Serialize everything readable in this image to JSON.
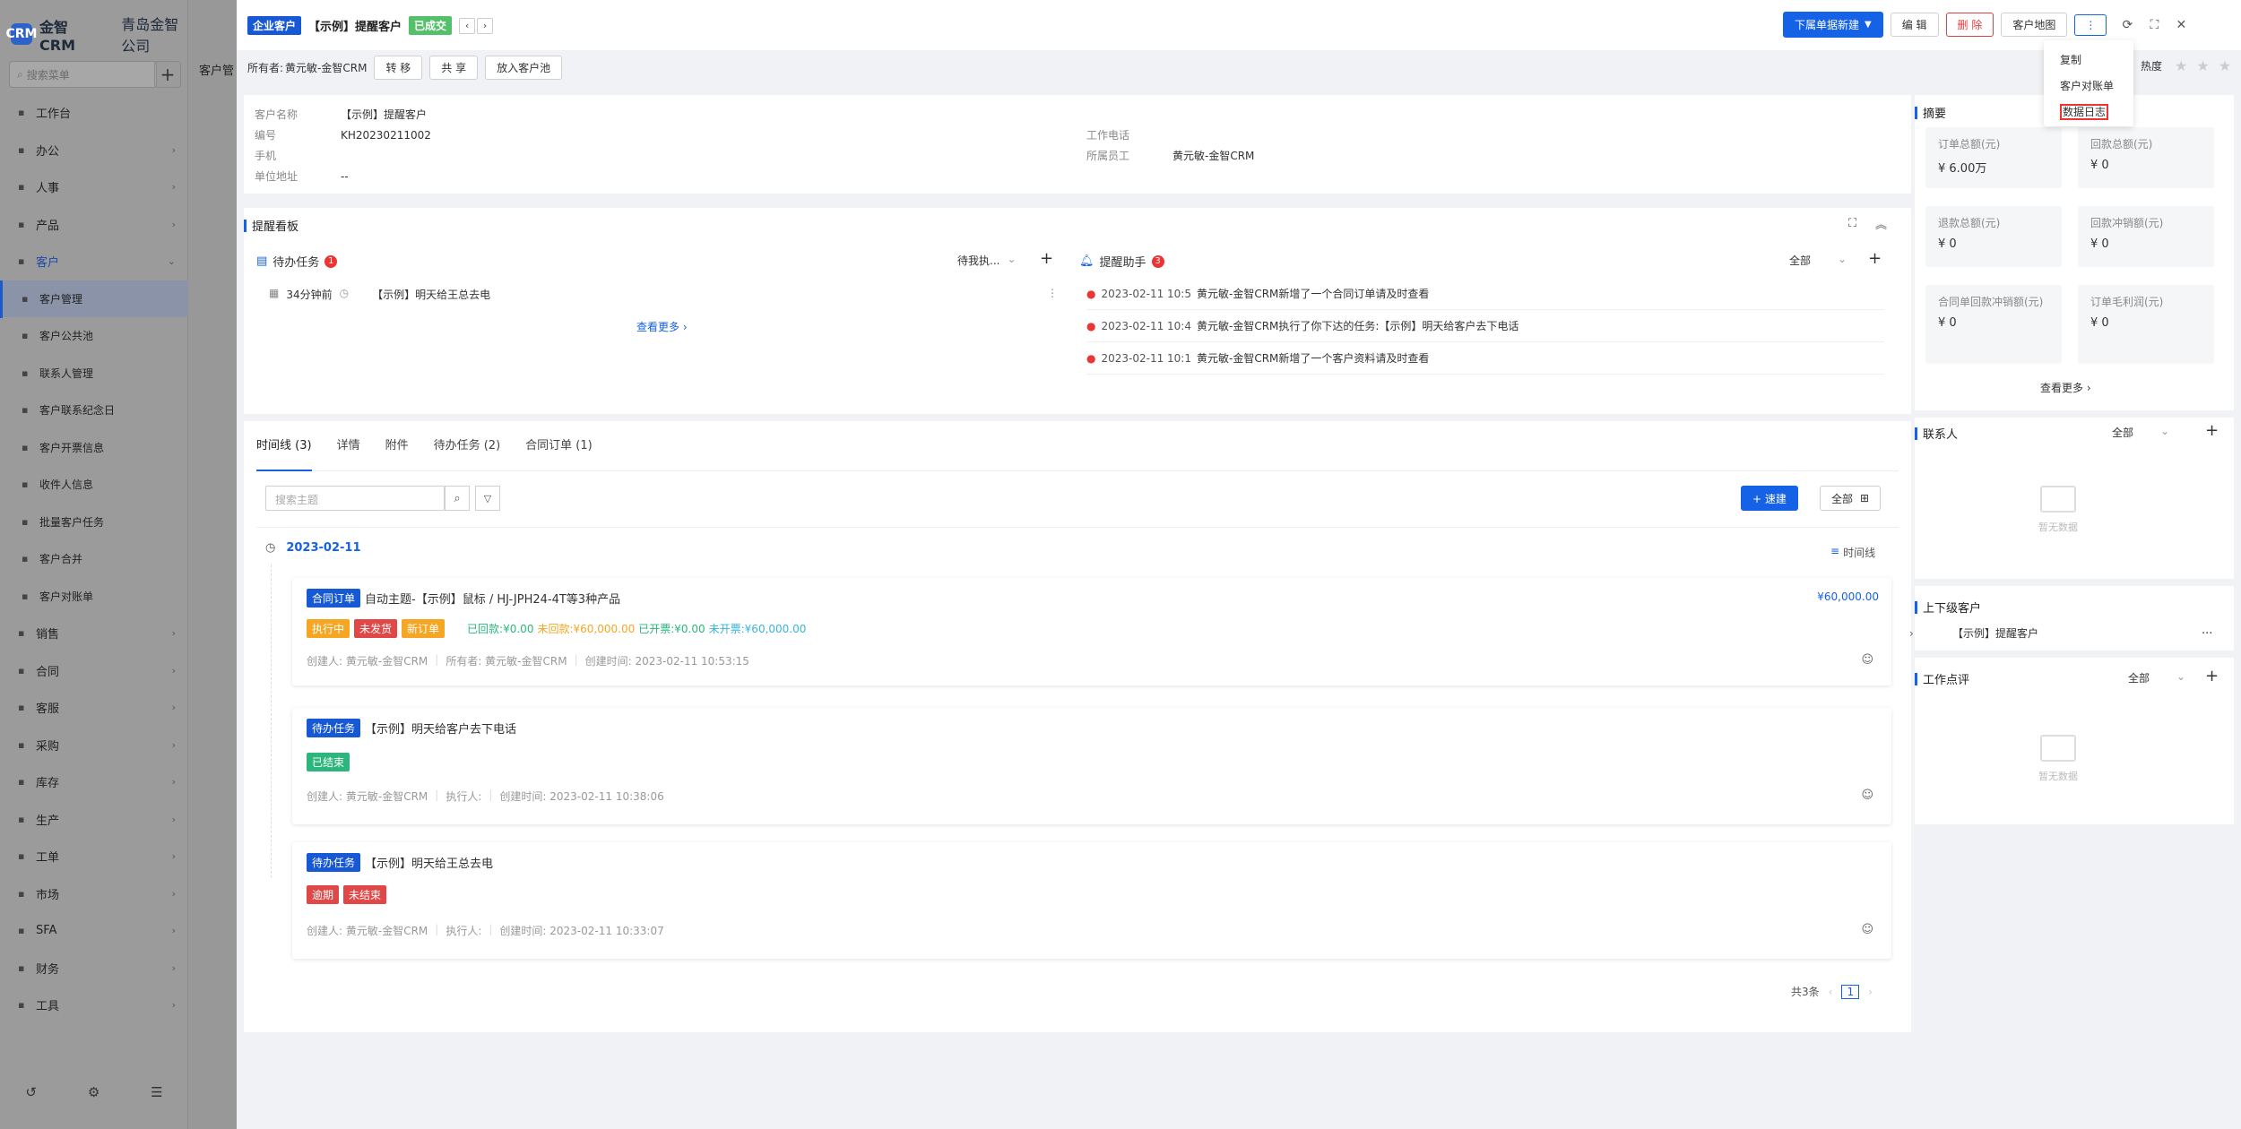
{
  "app": {
    "logo_text": "CRM",
    "name": "金智CRM",
    "company": "青岛金智公司",
    "search_placeholder": "搜索菜单"
  },
  "sidebar": {
    "items": [
      {
        "label": "工作台",
        "icon": "dashboard-icon",
        "arrow": ""
      },
      {
        "label": "办公",
        "icon": "office-icon",
        "arrow": "›"
      },
      {
        "label": "人事",
        "icon": "people-icon",
        "arrow": "›"
      },
      {
        "label": "产品",
        "icon": "product-icon",
        "arrow": "›"
      },
      {
        "label": "客户",
        "icon": "customer-icon",
        "arrow": "⌄"
      },
      {
        "label": "客户管理",
        "sub": true,
        "active": true
      },
      {
        "label": "客户公共池",
        "sub": true
      },
      {
        "label": "联系人管理",
        "sub": true
      },
      {
        "label": "客户联系纪念日",
        "sub": true
      },
      {
        "label": "客户开票信息",
        "sub": true
      },
      {
        "label": "收件人信息",
        "sub": true
      },
      {
        "label": "批量客户任务",
        "sub": true
      },
      {
        "label": "客户合并",
        "sub": true
      },
      {
        "label": "客户对账单",
        "sub": true
      },
      {
        "label": "销售",
        "icon": "sales-icon",
        "arrow": "›"
      },
      {
        "label": "合同",
        "icon": "contract-icon",
        "arrow": "›"
      },
      {
        "label": "客服",
        "icon": "service-icon",
        "arrow": "›"
      },
      {
        "label": "采购",
        "icon": "purchase-icon",
        "arrow": "›"
      },
      {
        "label": "库存",
        "icon": "stock-icon",
        "arrow": "›"
      },
      {
        "label": "生产",
        "icon": "production-icon",
        "arrow": "›"
      },
      {
        "label": "工单",
        "icon": "workorder-icon",
        "arrow": "›"
      },
      {
        "label": "市场",
        "icon": "market-icon",
        "arrow": "›"
      },
      {
        "label": "SFA",
        "icon": "sfa-icon",
        "arrow": "›"
      },
      {
        "label": "财务",
        "icon": "finance-icon",
        "arrow": "›"
      },
      {
        "label": "工具",
        "icon": "tools-icon",
        "arrow": "›"
      }
    ]
  },
  "midtab": "客户管",
  "header": {
    "type_tag": "企业客户",
    "title": "【示例】提醒客户",
    "status_tag": "已成交",
    "owner_label": "所有者:",
    "owner": "黄元敏-金智CRM",
    "transfer": "转 移",
    "share": "共 享",
    "to_pool": "放入客户池",
    "sub_new": "下属单据新建",
    "edit": "编 辑",
    "delete": "删 除",
    "map": "客户地图",
    "more": "⋮",
    "heat_label": "热度"
  },
  "dropdown": {
    "items": [
      "复制",
      "客户对账单",
      "数据日志"
    ]
  },
  "info": {
    "fields": [
      {
        "label": "客户名称",
        "value": "【示例】提醒客户"
      },
      {
        "label": "编号",
        "value": "KH20230211002"
      },
      {
        "label": "手机",
        "value": ""
      },
      {
        "label": "单位地址",
        "value": "--"
      }
    ],
    "right_fields": [
      {
        "label": "工作电话",
        "value": ""
      },
      {
        "label": "所属员工",
        "value": "黄元敏-金智CRM"
      }
    ]
  },
  "reminder": {
    "title": "提醒看板",
    "todo_title": "待办任务",
    "todo_count": "1",
    "todo_filter": "待我执...",
    "todo_item": {
      "time": "34分钟前",
      "text": "【示例】明天给王总去电"
    },
    "view_more": "查看更多 ›",
    "assist_title": "提醒助手",
    "assist_count": "3",
    "assist_filter": "全部",
    "assist_items": [
      {
        "time": "2023-02-11 10:5",
        "text": "黄元敏-金智CRM新增了一个合同订单请及时查看"
      },
      {
        "time": "2023-02-11 10:4",
        "text": "黄元敏-金智CRM执行了你下达的任务:【示例】明天给客户去下电话"
      },
      {
        "time": "2023-02-11 10:1",
        "text": "黄元敏-金智CRM新增了一个客户资料请及时查看"
      }
    ]
  },
  "tabs": [
    {
      "label": "时间线 (3)",
      "active": true
    },
    {
      "label": "详情"
    },
    {
      "label": "附件"
    },
    {
      "label": "待办任务 (2)"
    },
    {
      "label": "合同订单 (1)"
    }
  ],
  "timeline": {
    "search_placeholder": "搜索主题",
    "new_btn": "+ 速建",
    "all_btn": "全部",
    "date": "2023-02-11",
    "view_label": "时间线",
    "card1": {
      "type": "合同订单",
      "title": "自动主题-【示例】鼠标 / HJ-JPH24-4T等3种产品",
      "amount": "¥60,000.00",
      "tags": [
        "执行中",
        "未发货",
        "新订单"
      ],
      "s1l": "已回款:",
      "s1v": "¥0.00",
      "s2l": "未回款:",
      "s2v": "¥60,000.00",
      "s3l": "已开票:",
      "s3v": "¥0.00",
      "s4l": "未开票:",
      "s4v": "¥60,000.00",
      "meta": [
        "创建人: 黄元敏-金智CRM",
        "所有者: 黄元敏-金智CRM",
        "创建时间: 2023-02-11 10:53:15"
      ]
    },
    "card2": {
      "type": "待办任务",
      "title": "【示例】明天给客户去下电话",
      "tag": "已结束",
      "meta": [
        "创建人: 黄元敏-金智CRM",
        "执行人:",
        "创建时间: 2023-02-11 10:38:06"
      ]
    },
    "card3": {
      "type": "待办任务",
      "title": "【示例】明天给王总去电",
      "tags": [
        "逾期",
        "未结束"
      ],
      "meta": [
        "创建人: 黄元敏-金智CRM",
        "执行人:",
        "创建时间: 2023-02-11 10:33:07"
      ]
    },
    "total": "共3条",
    "page": "1"
  },
  "summary": {
    "title": "摘要",
    "boxes": [
      {
        "label": "订单总额(元)",
        "value": "¥ 6.00万"
      },
      {
        "label": "回款总额(元)",
        "value": "¥ 0"
      },
      {
        "label": "退款总额(元)",
        "value": "¥ 0"
      },
      {
        "label": "回款冲销额(元)",
        "value": "¥ 0"
      },
      {
        "label": "合同单回款冲销额(元)",
        "value": "¥ 0"
      },
      {
        "label": "订单毛利润(元)",
        "value": "¥ 0"
      }
    ],
    "view_more": "查看更多 ›"
  },
  "contacts": {
    "title": "联系人",
    "filter": "全部",
    "empty": "暂无数据"
  },
  "parent": {
    "title": "上下级客户",
    "item": "【示例】提醒客户",
    "more": "..."
  },
  "review": {
    "title": "工作点评",
    "filter": "全部",
    "empty": "暂无数据"
  }
}
